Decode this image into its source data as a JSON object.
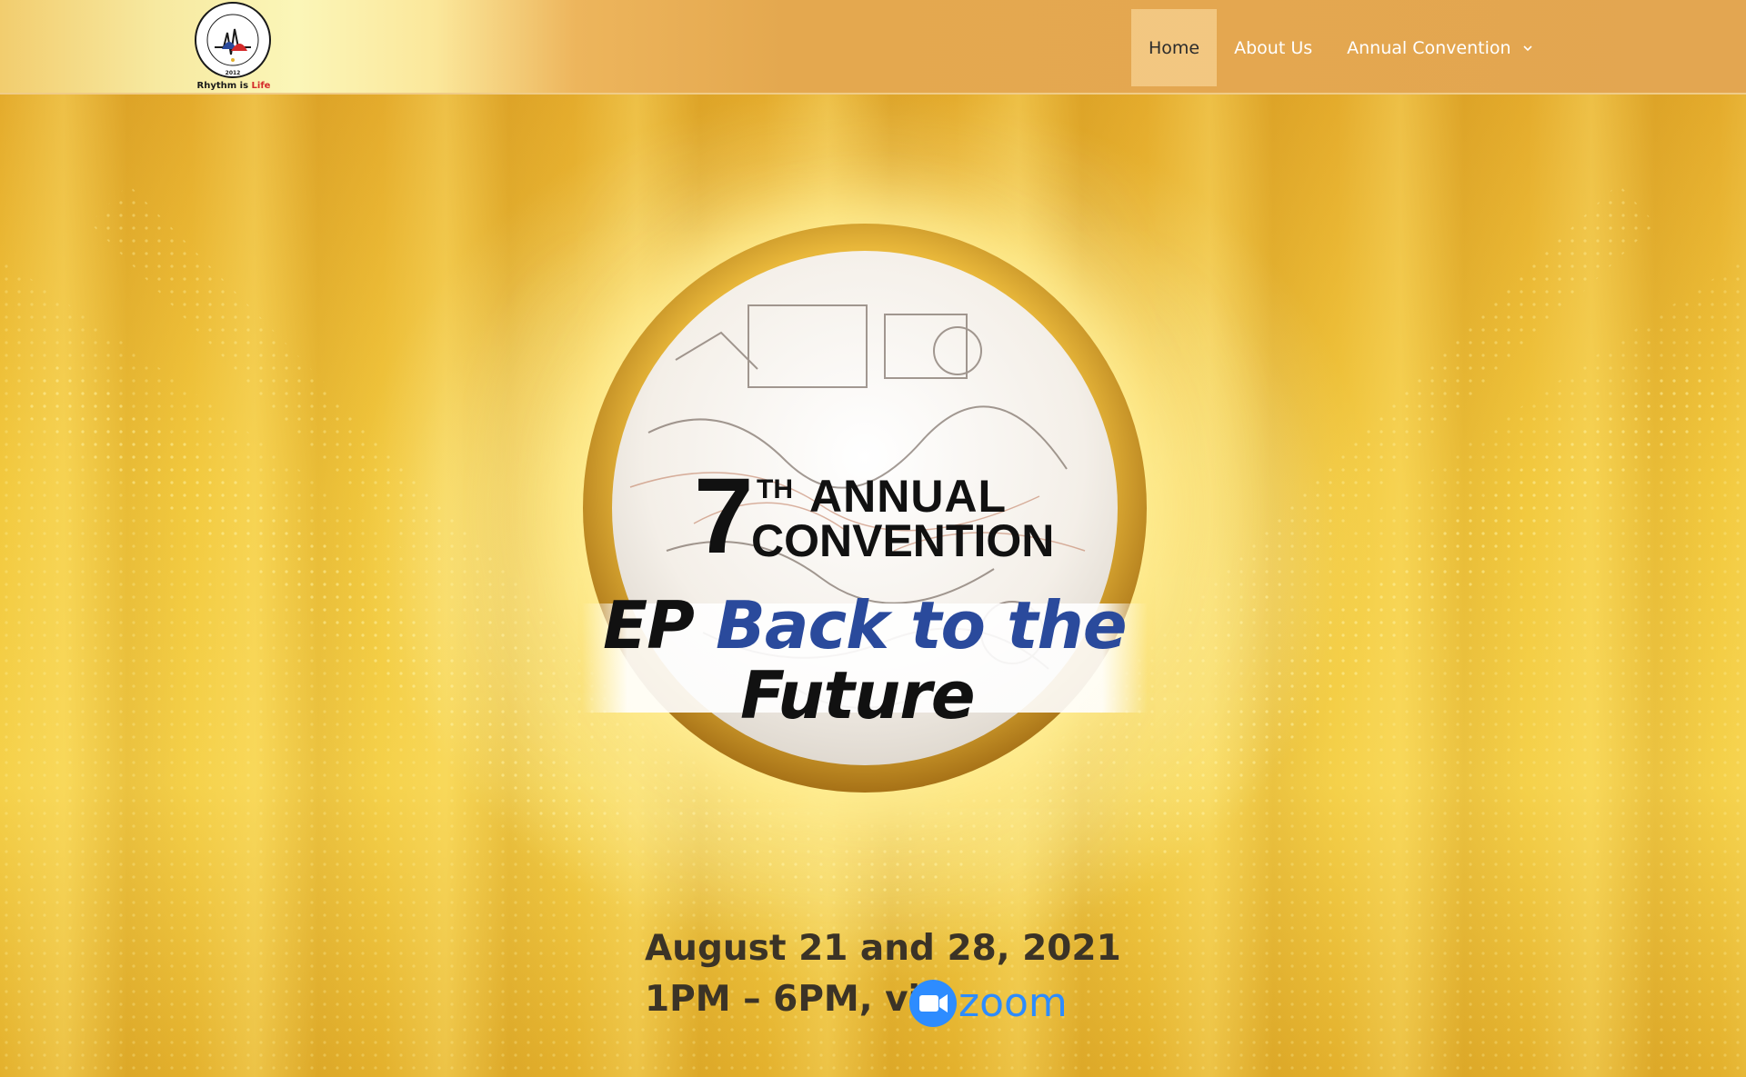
{
  "header": {
    "logo": {
      "seal_text": "PHILIPPINE HEART RHYTHM SOCIETY",
      "seal_year": "2012",
      "tagline_prefix": "Rhythm is ",
      "tagline_highlight": "Life"
    },
    "nav": [
      {
        "label": "Home",
        "active": true
      },
      {
        "label": "About Us",
        "active": false
      },
      {
        "label": "Annual Convention",
        "active": false,
        "has_dropdown": true
      }
    ]
  },
  "hero": {
    "ordinal_number": "7",
    "ordinal_suffix": "TH",
    "title_line1": "ANNUAL",
    "title_line2": "CONVENTION",
    "theme_prefix": "EP ",
    "theme_highlight": "Back to the",
    "theme_line2": "Future",
    "date_text": "August 21 and 28, 2021",
    "time_text": "1PM – 6PM, via",
    "platform_logo_text": "zoom"
  },
  "colors": {
    "header_bg": "#e3a651",
    "nav_text": "#ffffff",
    "nav_active_text": "#2b2b2b",
    "theme_blue": "#2a4a9c",
    "zoom_blue": "#2d8cff",
    "logo_red": "#d42a2a"
  },
  "icons": {
    "dropdown": "chevron-down-icon",
    "zoom": "zoom-camera-icon"
  }
}
